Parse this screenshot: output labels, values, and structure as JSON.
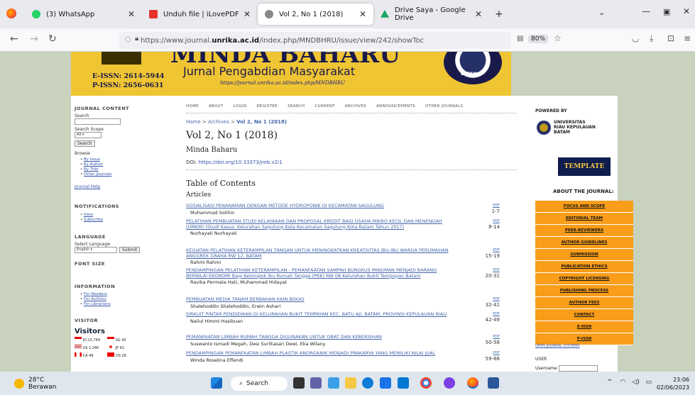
{
  "browser": {
    "tabs": [
      {
        "label": "(3) WhatsApp",
        "color": "#25d366"
      },
      {
        "label": "Unduh file | iLovePDF",
        "color": "#e5322d"
      },
      {
        "label": "Vol 2, No 1 (2018)",
        "color": "#888888"
      },
      {
        "label": "Drive Saya - Google Drive",
        "color": "#1fa463"
      }
    ],
    "url_prefix": "https://www.journal.",
    "url_domain": "unrika.ac.id",
    "url_rest": "/index.php/MNDBHRU/issue/view/242/showToc",
    "zoom": "80%"
  },
  "banner": {
    "title": "MINDA BAHARU",
    "subtitle": "Jurnal Pengabdian Masyarakat",
    "url": "https://journal.unrika.ac.id/index.php/MNDBHRU",
    "eissn": "E-ISSN: 2614-5944",
    "pissn": "P-ISSN: 2656-0631",
    "seal_text": "BATAM"
  },
  "sidebar": {
    "journal_content": "JOURNAL CONTENT",
    "search_label": "Search",
    "search_scope_label": "Search Scope",
    "scope_value": "All",
    "search_button": "Search",
    "browse_label": "Browse",
    "browse_links": [
      "By Issue",
      "By Author",
      "By Title",
      "Other Journals"
    ],
    "journal_help": "Journal Help",
    "notifications": "NOTIFICATIONS",
    "notif_links": [
      "View",
      "Subscribe"
    ],
    "language": "LANGUAGE",
    "select_language": "Select Language",
    "language_value": "English",
    "submit": "Submit",
    "font_size": "FONT SIZE",
    "information": "INFORMATION",
    "info_links": [
      "For Readers",
      "For Authors",
      "For Librarians"
    ],
    "visitor": "VISITOR",
    "visitors_title": "Visitors",
    "visitor_stats": [
      "ID 15,749",
      "SG 43",
      "US 1,340",
      "JP 42",
      "CA 49",
      "CN 28"
    ]
  },
  "topnav": [
    "HOME",
    "ABOUT",
    "LOGIN",
    "REGISTER",
    "SEARCH",
    "CURRENT",
    "ARCHIVES",
    "ANNOUNCEMENTS",
    "OTHER JOURNALS"
  ],
  "breadcrumb": {
    "home": "Home",
    "sep1": " > ",
    "archives": "Archives",
    "sep2": " > ",
    "current": "Vol 2, No 1 (2018)"
  },
  "issue_title": "Vol 2, No 1 (2018)",
  "journal_name": "Minda Baharu",
  "doi_label": "DOI: ",
  "doi_link": "https://doi.org/10.33373/jmb.v2i1",
  "toc_title": "Table of Contents",
  "articles_label": "Articles",
  "articles": [
    {
      "title": "SOSIALISASI PENANAMAN DENGAN METODE HYDROPONIK DI KECAMATAN SAGULUNG",
      "authors": "Muhammad Solihin",
      "pdf": "PDF",
      "pages": "1-7"
    },
    {
      "title": "PELATIHAN PEMBUATAN STUDI KELAYAKAN DAN PROPOSAL KREDIT BAGI USAHA MIKRO KECIL DAN MENENGAH (UMKM) (Studi Kasus: Kelurahan Sagulung Kota Kecamatan Sagulung Kota Batam Tahun 2017)",
      "authors": "Nurhayati Nurhayati",
      "pdf": "PDF",
      "pages": "8-14"
    },
    {
      "title": "KEGIATAN PELATIHAN KETERAMPILAN TANGAN UNTUK MENINGKATKAN KREATIVITAS IBU-IBU WARGA PERUMAHAN ANGGREK GRAHA RW 12, BATAM",
      "authors": "Rahmi Rahmi",
      "pdf": "PDF",
      "pages": "15-19"
    },
    {
      "title": "PENDAMPINGAN PELATIHAN KETERAMPILAN - PEMANFAATAN SAMPAH BUNGKUS MINUMAN MENJADI BARANG BERNILAI EKONOMI Bagi Kelompok Ibu Rumah Tangga (PKK) RW 08 Kelurahan Bukit Tempayan Batam",
      "authors": "Ravika Permata Hati, Muhammad Hidayat",
      "pdf": "PDF",
      "pages": "20-31"
    },
    {
      "title": "PEMBUATAN MEDIA TANAM BERBAHAN KAIN BEKAS",
      "authors": "Shalehoddin Shalehoddin, Erwin Ashari",
      "pdf": "PDF",
      "pages": "32-41"
    },
    {
      "title": "SIRKUIT PINTAR PENDIDIKAN DI KELURAHAN BUKIT TEMPAYAN KEC. BATU AJI, BATAM, PROVINSI KEPULAUAN RIAU",
      "authors": "Nailul Himmi Hasibuan",
      "pdf": "PDF",
      "pages": "42-49"
    },
    {
      "title": "PEMANFAATAN LIMBAH RUMAH TANGGA DIGUNAKAN UNTUK OBAT DAN KEBERSIHAN",
      "authors": "Suswanto Ismadi Megah, Desi Surlitasari Dewi, Eka Wilany",
      "pdf": "PDF",
      "pages": "50-58"
    },
    {
      "title": "PENDAMPINGAN PEMANFAATAN LIMBAH PLASTIK ANORGANIK MENJADI PRAKARYA YANG MEMILIKI NILAI JUAL",
      "authors": "Winda Roselina Effendi",
      "pdf": "PDF",
      "pages": "59-66"
    }
  ],
  "right": {
    "powered_by": "POWERED BY",
    "unri_lines": [
      "UNIVERSITAS",
      "RIAU KEPULAUAN",
      "BATAM"
    ],
    "template": "TEMPLATE",
    "about_journal": "ABOUT THE JOURNAL:",
    "menu": [
      "FOCUS AND SCOPE",
      "EDITORIAL TEAM",
      "PEER-REVIEWERS",
      "AUTHOR GUIDELINES",
      "SUBMISSION",
      "PUBLICATION ETHICS",
      "COPYRIGHT LICENSING",
      "PUBLISHING PROCESS",
      "AUTHOR FEES",
      "CONTACT",
      "E-ISSN",
      "P-ISSN"
    ],
    "open_journal": "OPEN JOURNAL SYSTEMS",
    "user": "USER",
    "username": "Username"
  },
  "taskbar": {
    "temp": "28°C",
    "weather": "Berawan",
    "search": "Search",
    "time": "23:06",
    "date": "02/06/2023"
  }
}
